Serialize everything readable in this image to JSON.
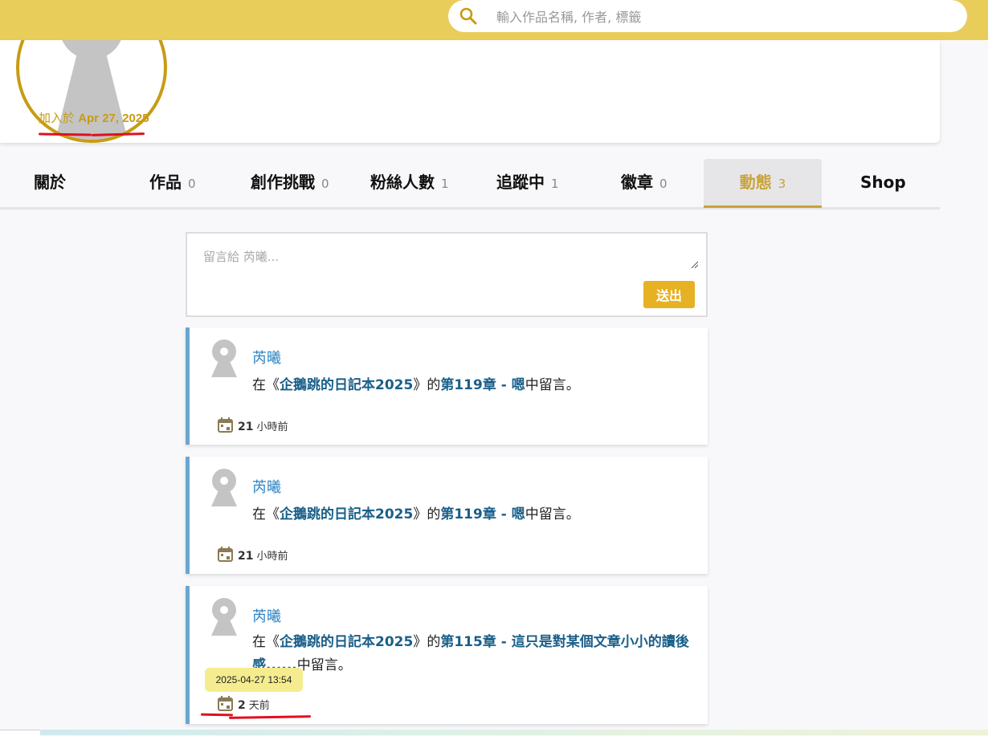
{
  "search": {
    "placeholder": "輸入作品名稱, 作者, 標籤"
  },
  "profile": {
    "joined_prefix": "加入於",
    "joined_date": "Apr 27, 2025"
  },
  "tabs": [
    {
      "label": "關於",
      "count": ""
    },
    {
      "label": "作品",
      "count": "0"
    },
    {
      "label": "創作挑戰",
      "count": "0"
    },
    {
      "label": "粉絲人數",
      "count": "1"
    },
    {
      "label": "追蹤中",
      "count": "1"
    },
    {
      "label": "徽章",
      "count": "0"
    },
    {
      "label": "動態",
      "count": "3"
    },
    {
      "label": "Shop",
      "count": ""
    }
  ],
  "composer": {
    "placeholder": "留言給 芮曦...",
    "send_label": "送出"
  },
  "activities": [
    {
      "user": "芮曦",
      "prefix": "在《",
      "book": "企鵝跳的日記本2025",
      "mid": "》的",
      "chapter": "第119章 - 嗯",
      "suffix": "中留言。",
      "time_num": "21",
      "time_unit": "小時前"
    },
    {
      "user": "芮曦",
      "prefix": "在《",
      "book": "企鵝跳的日記本2025",
      "mid": "》的",
      "chapter": "第119章 - 嗯",
      "suffix": "中留言。",
      "time_num": "21",
      "time_unit": "小時前"
    },
    {
      "user": "芮曦",
      "prefix": "在《",
      "book": "企鵝跳的日記本2025",
      "mid": "》的",
      "chapter": "第115章 - 這只是對某個文章小小的讀後感......",
      "suffix": "中留言。",
      "time_num": "2",
      "time_unit": "天前"
    }
  ],
  "tooltip": "2025-04-27 13:54",
  "colors": {
    "header": "#e9cd5b",
    "accent": "#c79c14",
    "link": "#2b83c4",
    "card_border": "#6aa7cf",
    "button": "#e6b223",
    "annotation": "#e01020"
  }
}
